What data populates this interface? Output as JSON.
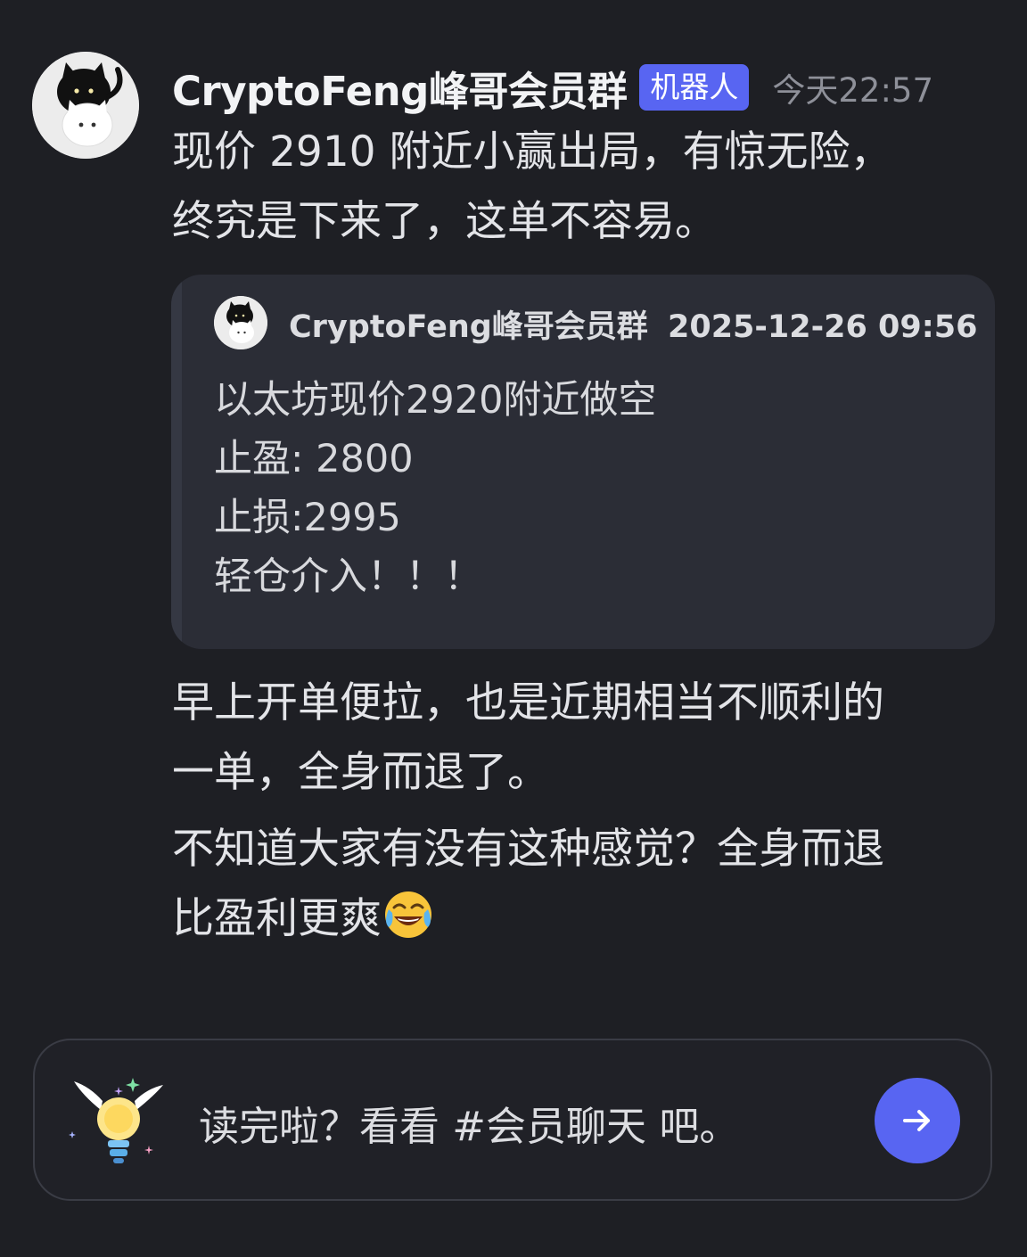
{
  "message": {
    "author": "CryptoFeng峰哥会员群",
    "bot_badge": "机器人",
    "timestamp": "今天22:57",
    "lines_1": [
      "现价 2910 附近小赢出局，有惊无险，",
      "终究是下来了，这单不容易。"
    ],
    "quote": {
      "author": "CryptoFeng峰哥会员群",
      "datetime": "2025-12-26 09:56",
      "lines": [
        "以太坊现价2920附近做空",
        "止盈: 2800",
        "止损:2995",
        "轻仓介入！！！"
      ]
    },
    "lines_2": [
      "早上开单便拉，也是近期相当不顺利的",
      "一单，全身而退了。"
    ],
    "lines_3": [
      "不知道大家有没有这种感觉？全身而退",
      "比盈利更爽"
    ],
    "emoji": "face-with-tears-of-joy-icon"
  },
  "prompt": {
    "text": "读完啦？看看 #会员聊天 吧。",
    "icon": "winged-lightbulb-icon",
    "button_icon": "arrow-right-icon"
  },
  "colors": {
    "background": "#1e1f24",
    "accent": "#5865f2",
    "quote_background": "#2b2d36"
  }
}
